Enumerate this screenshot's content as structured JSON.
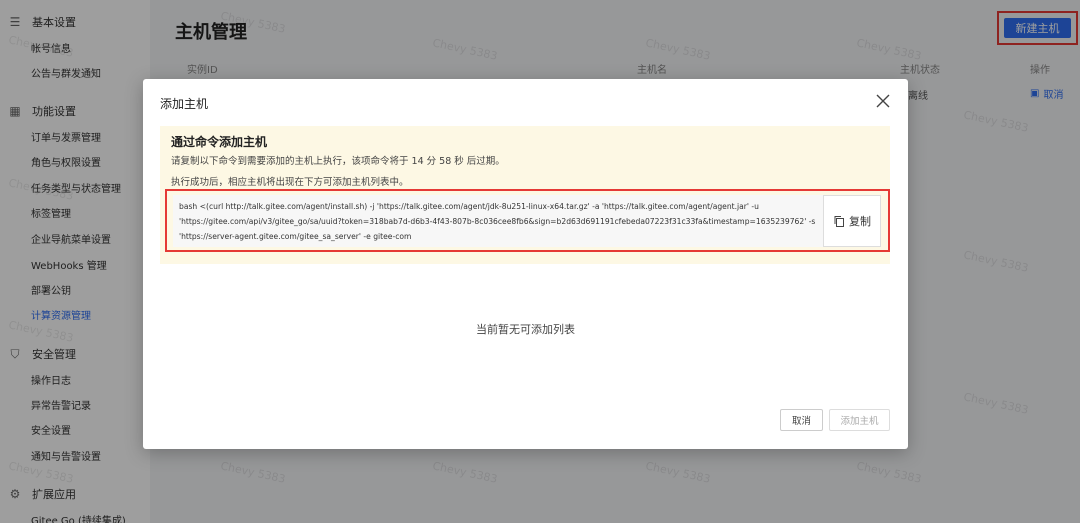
{
  "sidebar": {
    "groups": [
      {
        "icon": "sliders-icon",
        "label": "基本设置",
        "items": [
          "帐号信息",
          "公告与群发通知"
        ]
      },
      {
        "icon": "grid-icon",
        "label": "功能设置",
        "items": [
          "订单与发票管理",
          "角色与权限设置",
          "任务类型与状态管理",
          "标签管理",
          "企业导航菜单设置",
          "WebHooks 管理",
          "部署公钥",
          "计算资源管理"
        ]
      },
      {
        "icon": "shield-icon",
        "label": "安全管理",
        "items": [
          "操作日志",
          "异常告警记录",
          "安全设置",
          "通知与告警设置"
        ]
      },
      {
        "icon": "gear-icon",
        "label": "扩展应用",
        "items": [
          "Gitee Go (持续集成)"
        ]
      }
    ],
    "active_item": "计算资源管理"
  },
  "main": {
    "title": "主机管理",
    "new_host_button": "新建主机",
    "table": {
      "headers": [
        "实例ID",
        "主机名",
        "主机状态",
        "操作"
      ],
      "row": {
        "status": "离线",
        "action": "取消"
      }
    }
  },
  "watermark": "Chevy 5383",
  "modal": {
    "title": "添加主机",
    "notice": {
      "title": "通过命令添加主机",
      "line1": "请复制以下命令到需要添加的主机上执行，该项命令将于 14 分 58 秒 后过期。",
      "line2": "执行成功后，相应主机将出现在下方可添加主机列表中。"
    },
    "command": [
      "bash <(curl http://talk.gitee.com/agent/install.sh) -j 'https://talk.gitee.com/agent/jdk-8u251-linux-x64.tar.gz' -a 'https://talk.gitee.com/agent/agent.jar' -u",
      "'https://gitee.com/api/v3/gitee_go/sa/uuid?token=318bab7d-d6b3-4f43-807b-8c036cee8fb6&sign=b2d63d691191cfebeda07223f31c33fa&timestamp=1635239762' -s",
      "'https://server-agent.gitee.com/gitee_sa_server' -e gitee-com"
    ],
    "copy_button": "复制",
    "empty_text": "当前暂无可添加列表",
    "cancel_button": "取消",
    "add_button": "添加主机"
  },
  "colors": {
    "primary": "#2f6ff2",
    "highlight": "#e53935",
    "notice_bg": "#fdf8e4"
  }
}
